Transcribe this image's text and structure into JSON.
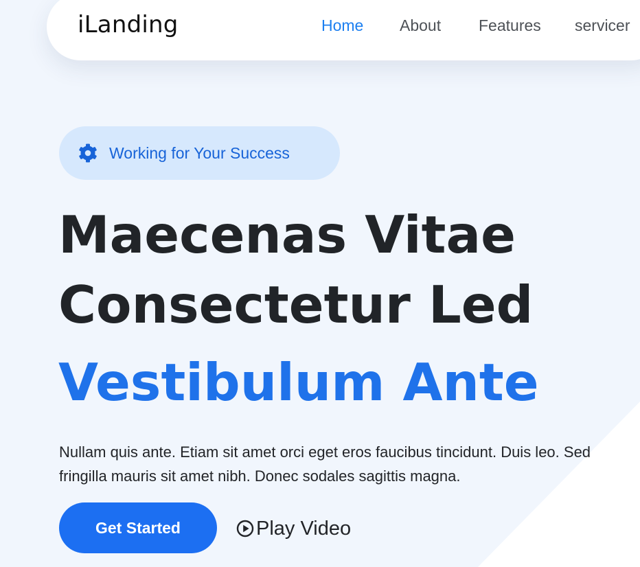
{
  "brand": {
    "logo": "iLanding"
  },
  "nav": {
    "items": [
      {
        "label": "Home",
        "active": true
      },
      {
        "label": "About",
        "active": false
      },
      {
        "label": "Features",
        "active": false
      },
      {
        "label": "servicer",
        "active": false
      }
    ]
  },
  "hero": {
    "badge": {
      "icon": "gear-icon",
      "text": "Working for Your Success"
    },
    "title_line1": "Maecenas Vitae",
    "title_line2": "Consectetur Led",
    "title_highlight": "Vestibulum Ante",
    "description": "Nullam quis ante. Etiam sit amet orci eget eros faucibus tincidunt. Duis leo. Sed fringilla mauris sit amet nibh. Donec sodales sagittis magna.",
    "primary_button": "Get Started",
    "video_link": {
      "icon": "play-circle-icon",
      "label": "Play Video"
    }
  },
  "colors": {
    "accent": "#1c7ff0",
    "primary_button": "#1c6ff2",
    "highlight_text": "#1f72ea",
    "badge_bg": "#d6e8fd",
    "page_bg": "#f1f6fd"
  }
}
